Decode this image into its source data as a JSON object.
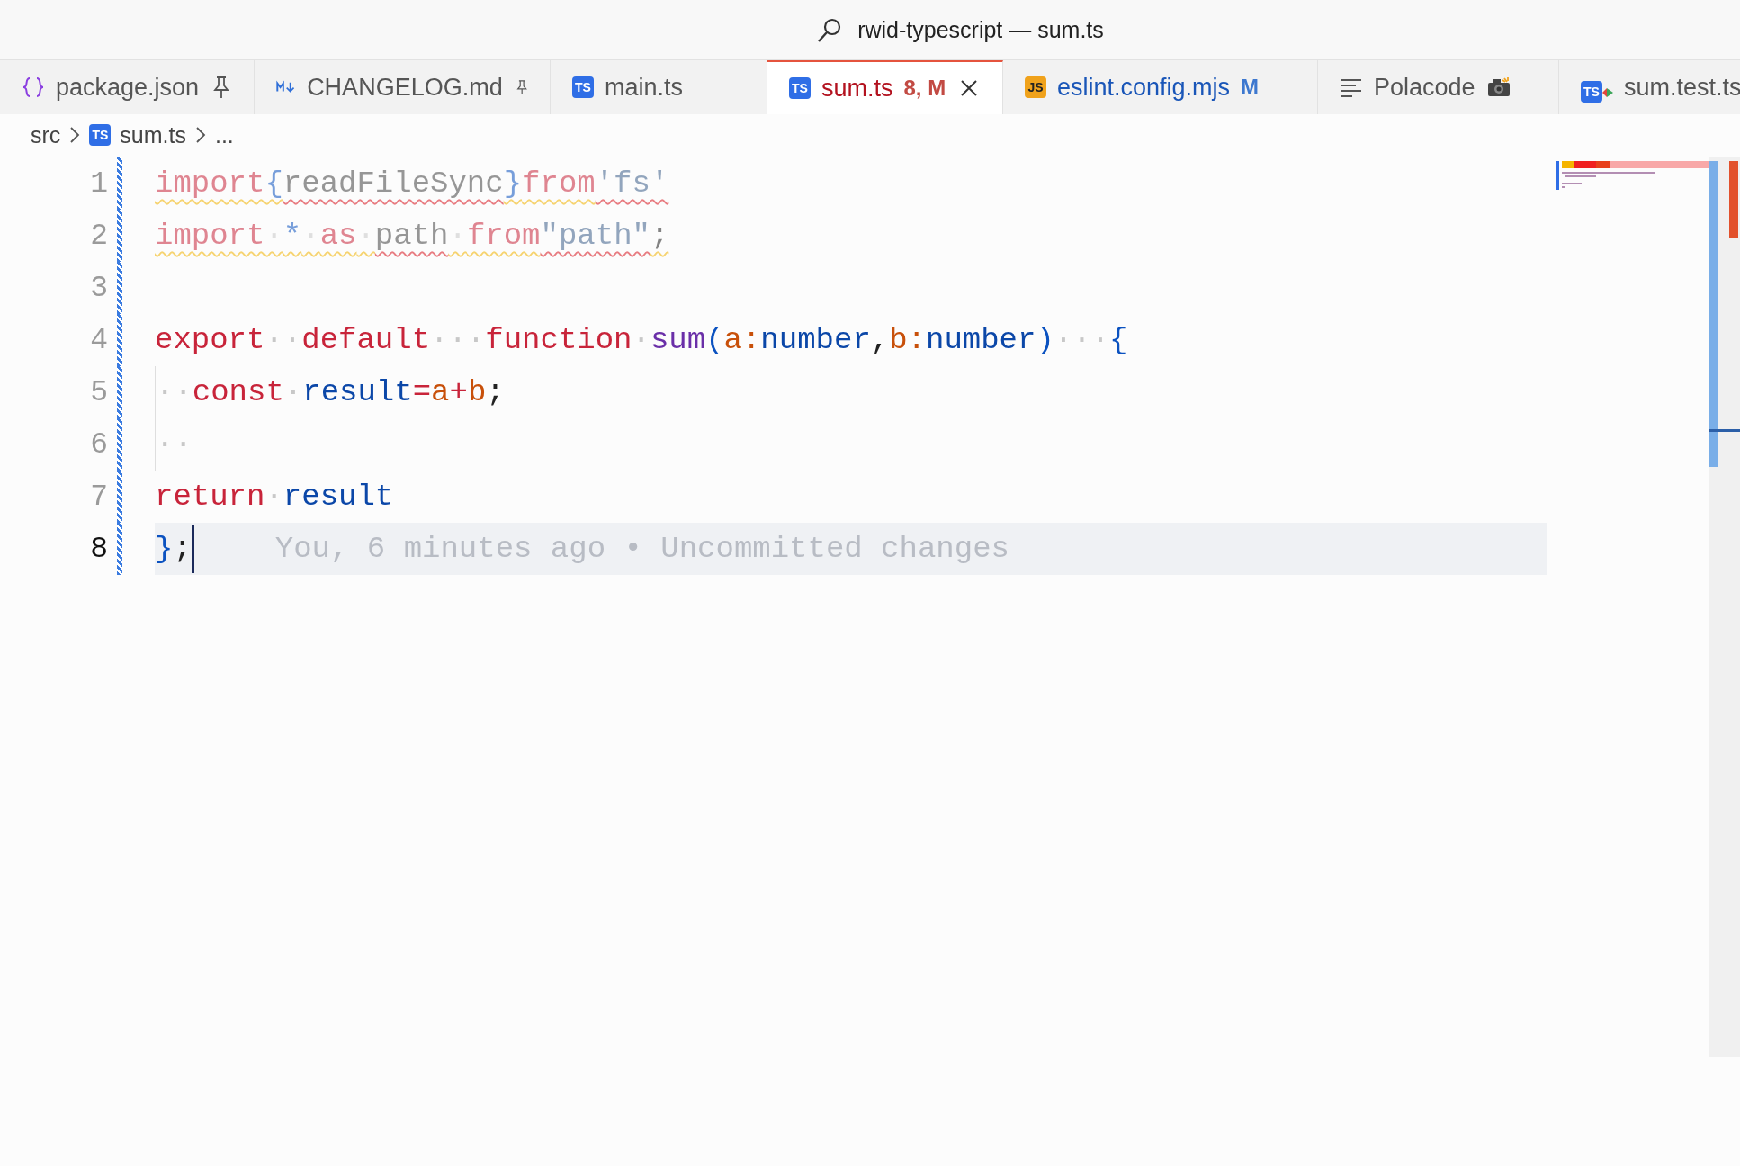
{
  "window": {
    "title": "rwid-typescript — sum.ts"
  },
  "tabs": [
    {
      "label": "package.json",
      "kind": "json",
      "pinned": true,
      "selected": false,
      "errors": false,
      "modified": false
    },
    {
      "label": "CHANGELOG.md",
      "kind": "markdown",
      "pinned": true,
      "selected": false,
      "errors": false,
      "modified": false
    },
    {
      "label": "main.ts",
      "kind": "typescript",
      "icon_text": "TS",
      "pinned": false,
      "selected": false,
      "errors": false,
      "modified": false
    },
    {
      "label": "sum.ts",
      "kind": "typescript",
      "icon_text": "TS",
      "pinned": false,
      "selected": true,
      "errors": true,
      "decoration": "8, M"
    },
    {
      "label": "eslint.config.mjs",
      "kind": "javascript",
      "icon_text": "JS",
      "pinned": false,
      "selected": false,
      "errors": false,
      "modified": true,
      "decoration": "M"
    },
    {
      "label": "Polacode",
      "kind": "outline",
      "pinned": false,
      "selected": false,
      "errors": false,
      "modified": false,
      "camera": true
    },
    {
      "label": "sum.test.ts",
      "kind": "test",
      "icon_text": "TS",
      "pinned": false,
      "selected": false,
      "errors": false,
      "modified": false
    }
  ],
  "breadcrumb": [
    {
      "label": "src"
    },
    {
      "label": "sum.ts",
      "kind": "typescript",
      "icon_text": "TS"
    },
    {
      "label": "..."
    }
  ],
  "editor": {
    "lines": [
      {
        "number": "1",
        "faded": true,
        "warning": true,
        "current": false,
        "tokens": [
          {
            "text": "import",
            "kind": "keyword",
            "error": false
          },
          {
            "text": "{",
            "kind": "brace",
            "error": false
          },
          {
            "text": "readFileSync",
            "kind": "plain",
            "error": true
          },
          {
            "text": "}",
            "kind": "brace",
            "error": false
          },
          {
            "text": "from",
            "kind": "keyword",
            "error": false
          },
          {
            "text": "'fs'",
            "kind": "string",
            "error": true
          }
        ]
      },
      {
        "number": "2",
        "faded": true,
        "warning": true,
        "current": false,
        "tokens": [
          {
            "text": "import",
            "kind": "keyword",
            "error": false
          },
          {
            "text": "·",
            "kind": "ws",
            "error": false
          },
          {
            "text": "*",
            "kind": "brace",
            "error": false
          },
          {
            "text": "·",
            "kind": "ws",
            "error": false
          },
          {
            "text": "as",
            "kind": "keyword",
            "error": false
          },
          {
            "text": "·",
            "kind": "ws",
            "error": false
          },
          {
            "text": "path",
            "kind": "plain",
            "error": true
          },
          {
            "text": "·",
            "kind": "ws",
            "error": false
          },
          {
            "text": "from",
            "kind": "keyword",
            "error": false
          },
          {
            "text": "\"path\"",
            "kind": "string",
            "error": true
          },
          {
            "text": ";",
            "kind": "punct",
            "error": false
          }
        ]
      },
      {
        "number": "3",
        "current": false
      },
      {
        "number": "4",
        "current": false,
        "tokens": [
          {
            "text": "export",
            "kind": "keyword"
          },
          {
            "text": "··",
            "kind": "ws"
          },
          {
            "text": "default",
            "kind": "keyword"
          },
          {
            "text": "···",
            "kind": "ws"
          },
          {
            "text": "function",
            "kind": "keyword"
          },
          {
            "text": "·",
            "kind": "ws"
          },
          {
            "text": "sum",
            "kind": "func"
          },
          {
            "text": "(",
            "kind": "brace"
          },
          {
            "text": "a",
            "kind": "param"
          },
          {
            "text": ":",
            "kind": "param"
          },
          {
            "text": "number",
            "kind": "ident"
          },
          {
            "text": ",",
            "kind": "punct"
          },
          {
            "text": "b",
            "kind": "param"
          },
          {
            "text": ":",
            "kind": "param"
          },
          {
            "text": "number",
            "kind": "ident"
          },
          {
            "text": ")",
            "kind": "brace"
          },
          {
            "text": "···",
            "kind": "ws"
          },
          {
            "text": "{",
            "kind": "brace"
          }
        ]
      },
      {
        "number": "5",
        "current": false,
        "indent_guide": true,
        "tokens": [
          {
            "text": "··",
            "kind": "ws"
          },
          {
            "text": "const",
            "kind": "keyword"
          },
          {
            "text": "·",
            "kind": "ws"
          },
          {
            "text": "result",
            "kind": "ident"
          },
          {
            "text": "=",
            "kind": "keyword"
          },
          {
            "text": "a",
            "kind": "param"
          },
          {
            "text": "+",
            "kind": "keyword"
          },
          {
            "text": "b",
            "kind": "param"
          },
          {
            "text": ";",
            "kind": "punct"
          }
        ]
      },
      {
        "number": "6",
        "current": false,
        "indent_guide": true,
        "tokens": [
          {
            "text": "··",
            "kind": "ws"
          }
        ]
      },
      {
        "number": "7",
        "current": false,
        "tokens": [
          {
            "text": "return",
            "kind": "keyword"
          },
          {
            "text": "·",
            "kind": "ws"
          },
          {
            "text": "result",
            "kind": "ident"
          }
        ]
      },
      {
        "number": "8",
        "current": true,
        "blame": "You, 6 minutes ago • Uncommitted changes",
        "tokens": [
          {
            "text": "}",
            "kind": "brace"
          },
          {
            "text": ";",
            "kind": "punct"
          }
        ]
      }
    ]
  }
}
